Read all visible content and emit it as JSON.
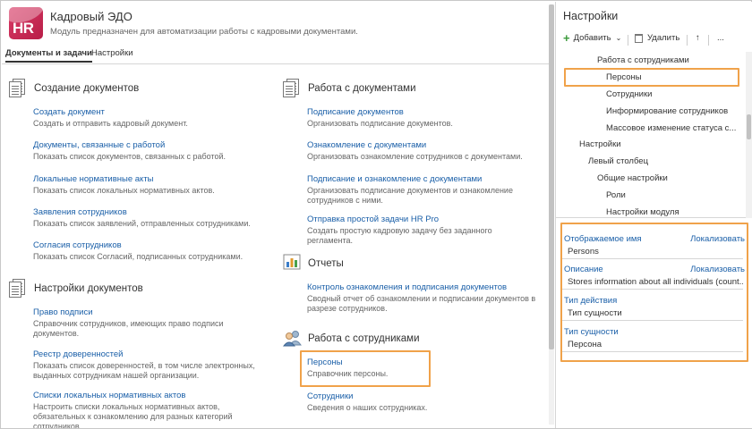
{
  "module": {
    "title": "Кадровый ЭДО",
    "subtitle": "Модуль предназначен для автоматизации работы с кадровыми документами.",
    "logo_text": "HR",
    "tabs": [
      "Документы и задачи",
      "Настройки"
    ]
  },
  "left_sections": [
    {
      "title": "Создание документов",
      "icon": "document-icon",
      "items": [
        {
          "link": "Создать документ",
          "desc": "Создать и отправить кадровый документ."
        },
        {
          "link": "Документы, связанные с работой",
          "desc": "Показать список документов, связанных с работой."
        },
        {
          "link": "Локальные нормативные акты",
          "desc": "Показать список локальных нормативных актов."
        },
        {
          "link": "Заявления сотрудников",
          "desc": "Показать список заявлений, отправленных сотрудниками."
        },
        {
          "link": "Согласия сотрудников",
          "desc": "Показать список Согласий, подписанных сотрудниками."
        }
      ]
    },
    {
      "title": "Настройки документов",
      "icon": "document-icon",
      "items": [
        {
          "link": "Право подписи",
          "desc": "Справочник сотрудников, имеющих право подписи документов."
        },
        {
          "link": "Реестр доверенностей",
          "desc": "Показать список доверенностей, в том числе электронных, выданных сотрудникам нашей организации."
        },
        {
          "link": "Списки локальных нормативных актов",
          "desc": "Настроить списки локальных нормативных актов, обязательных к ознакомлению для разных категорий сотрудников."
        }
      ]
    }
  ],
  "right_sections": [
    {
      "title": "Работа с документами",
      "icon": "document-icon",
      "items": [
        {
          "link": "Подписание документов",
          "desc": "Организовать подписание документов."
        },
        {
          "link": "Ознакомление с документами",
          "desc": "Организовать ознакомление сотрудников с документами."
        },
        {
          "link": "Подписание и ознакомление с документами",
          "desc": "Организовать подписание документов и ознакомление сотрудников с ними."
        },
        {
          "link": "Отправка простой задачи HR Pro",
          "desc": "Создать простую кадровую задачу без заданного регламента."
        }
      ]
    },
    {
      "title": "Отчеты",
      "icon": "chart-icon",
      "items": [
        {
          "link": "Контроль ознакомления и подписания документов",
          "desc": "Сводный отчет об ознакомлении и подписании документов в разрезе сотрудников."
        }
      ]
    },
    {
      "title": "Работа с сотрудниками",
      "icon": "people-icon",
      "items": [
        {
          "link": "Персоны",
          "desc": "Справочник персоны."
        },
        {
          "link": "Сотрудники",
          "desc": "Сведения о наших сотрудниках."
        }
      ]
    }
  ],
  "settings": {
    "title": "Настройки",
    "toolbar": {
      "add": "Добавить",
      "delete": "Удалить",
      "up": "↑",
      "more": "..."
    },
    "tree": [
      "Работа с сотрудниками",
      "Персоны",
      "Сотрудники",
      "Информирование сотрудников",
      "Массовое изменение статуса с...",
      "Настройки",
      "Левый столбец",
      "Общие настройки",
      "Роли",
      "Настройки модуля"
    ],
    "selected_tree_item": "Персоны",
    "properties": {
      "display_name_label": "Отображаемое имя",
      "display_name_value": "Persons",
      "localize": "Локализовать",
      "description_label": "Описание",
      "description_value": "Stores information about all individuals (count...",
      "action_type_label": "Тип действия",
      "action_type_value": "Тип сущности",
      "entity_type_label": "Тип сущности",
      "entity_type_value": "Персона"
    }
  },
  "colors": {
    "link": "#1a5fa8",
    "highlight": "#f0a24a",
    "add_icon": "#3b9a3b",
    "logo": "#c92a55"
  }
}
